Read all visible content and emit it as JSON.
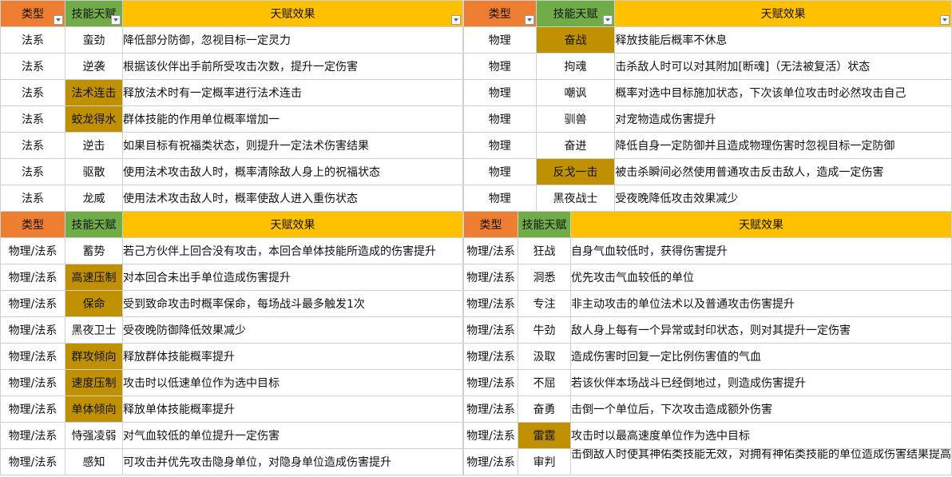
{
  "headers": {
    "type": "类型",
    "skill": "技能天赋",
    "effect": "天赋效果"
  },
  "colors": {
    "type_header": "#ed7d31",
    "skill_header": "#70ad47",
    "effect_header": "#ffc000",
    "highlight": "#bf9000"
  },
  "filter_icon": "filter-dropdown-icon",
  "blocks": [
    {
      "id": "block-top-left",
      "filter": true,
      "rows": [
        {
          "type": "法系",
          "skill": "蛮劲",
          "effect": "降低部分防御，忽视目标一定灵力",
          "hl": false
        },
        {
          "type": "法系",
          "skill": "逆袭",
          "effect": "根据该伙伴出手前所受攻击次数，提升一定伤害",
          "hl": false
        },
        {
          "type": "法系",
          "skill": "法术连击",
          "effect": "释放法术时有一定概率进行法术连击",
          "hl": true
        },
        {
          "type": "法系",
          "skill": "蛟龙得水",
          "effect": "群体技能的作用单位概率增加一",
          "hl": true
        },
        {
          "type": "法系",
          "skill": "逆击",
          "effect": "如果目标有祝福类状态，则提升一定法术伤害结果",
          "hl": false
        },
        {
          "type": "法系",
          "skill": "驱散",
          "effect": "使用法术攻击敌人时，概率清除敌人身上的祝福状态",
          "hl": false
        },
        {
          "type": "法系",
          "skill": "龙威",
          "effect": "使用法术攻击敌人时，概率使敌人进入重伤状态",
          "hl": false
        }
      ]
    },
    {
      "id": "block-top-right",
      "filter": true,
      "rows": [
        {
          "type": "物理",
          "skill": "奋战",
          "effect": "释放技能后概率不休息",
          "hl": true
        },
        {
          "type": "物理",
          "skill": "拘魂",
          "effect": "击杀敌人时可以对其附加[断魂]（无法被复活）状态",
          "hl": false
        },
        {
          "type": "物理",
          "skill": "嘲讽",
          "effect": "概率对选中目标施加状态，下次该单位攻击时必然攻击自己",
          "hl": false
        },
        {
          "type": "物理",
          "skill": "驯兽",
          "effect": "对宠物造成伤害提升",
          "hl": false
        },
        {
          "type": "物理",
          "skill": "奋进",
          "effect": "降低自身一定防御并且造成物理伤害时忽视目标一定防御",
          "hl": false
        },
        {
          "type": "物理",
          "skill": "反戈一击",
          "effect": "被击杀瞬间必然使用普通攻击反击敌人，造成一定伤害",
          "hl": true
        },
        {
          "type": "物理",
          "skill": "黑夜战士",
          "effect": "受夜晚降低攻击效果减少",
          "hl": false
        }
      ]
    },
    {
      "id": "block-bottom-left",
      "filter": false,
      "rows": [
        {
          "type": "物理/法系",
          "skill": "蓄势",
          "effect": "若己方伙伴上回合没有攻击，本回合单体技能所造成的伤害提升",
          "hl": false
        },
        {
          "type": "物理/法系",
          "skill": "高速压制",
          "effect": "对本回合未出手单位造成伤害提升",
          "hl": true
        },
        {
          "type": "物理/法系",
          "skill": "保命",
          "effect": "受到致命攻击时概率保命，每场战斗最多触发1次",
          "hl": true
        },
        {
          "type": "物理/法系",
          "skill": "黑夜卫士",
          "effect": "受夜晚防御降低效果减少",
          "hl": false
        },
        {
          "type": "物理/法系",
          "skill": "群攻倾向",
          "effect": "释放群体技能概率提升",
          "hl": true
        },
        {
          "type": "物理/法系",
          "skill": "速度压制",
          "effect": "攻击时以低速单位作为选中目标",
          "hl": true
        },
        {
          "type": "物理/法系",
          "skill": "单体倾向",
          "effect": "释放单体技能概率提升",
          "hl": true
        },
        {
          "type": "物理/法系",
          "skill": "恃强凌弱",
          "effect": "对气血较低的单位提升一定伤害",
          "hl": false
        },
        {
          "type": "物理/法系",
          "skill": "感知",
          "effect": "可攻击并优先攻击隐身单位，对隐身单位造成伤害提升",
          "hl": false
        }
      ]
    },
    {
      "id": "block-bottom-right",
      "filter": false,
      "rows": [
        {
          "type": "物理/法系",
          "skill": "狂战",
          "effect": "自身气血较低时，获得伤害提升",
          "hl": false
        },
        {
          "type": "物理/法系",
          "skill": "洞悉",
          "effect": "优先攻击气血较低的单位",
          "hl": false
        },
        {
          "type": "物理/法系",
          "skill": "专注",
          "effect": "非主动攻击的单位法术以及普通攻击伤害提升",
          "hl": false
        },
        {
          "type": "物理/法系",
          "skill": "牛劲",
          "effect": "敌人身上每有一个异常或封印状态，则对其提升一定伤害",
          "hl": false
        },
        {
          "type": "物理/法系",
          "skill": "汲取",
          "effect": "造成伤害时回复一定比例伤害值的气血",
          "hl": false
        },
        {
          "type": "物理/法系",
          "skill": "不屈",
          "effect": "若该伙伴本场战斗已经倒地过，则造成伤害提升",
          "hl": false
        },
        {
          "type": "物理/法系",
          "skill": "奋勇",
          "effect": "击倒一个单位后，下次攻击造成额外伤害",
          "hl": false
        },
        {
          "type": "物理/法系",
          "skill": "雷霆",
          "effect": "攻击时以最高速度单位作为选中目标",
          "hl": true
        },
        {
          "type": "物理/法系",
          "skill": "审判",
          "effect": "击倒敌人时使其神佑类技能无效，对拥有神佑类技能的单位造成伤害结果提高",
          "hl": false,
          "wrap": true
        }
      ]
    }
  ]
}
